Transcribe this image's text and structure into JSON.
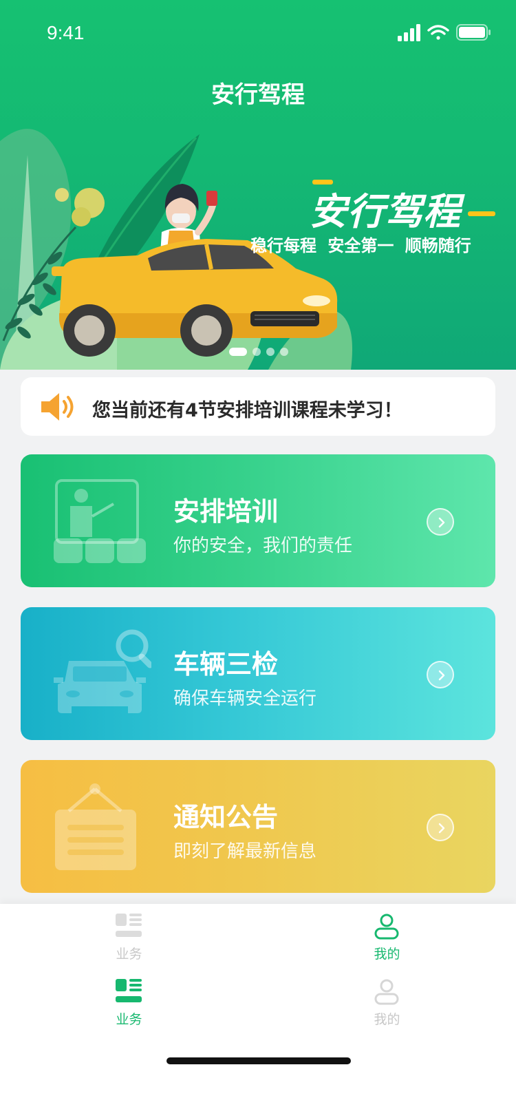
{
  "status_bar": {
    "time": "9:41"
  },
  "header": {
    "title": "安行驾程"
  },
  "banner": {
    "slogan": "安行驾程",
    "tagline": "稳行每程 安全第一 顺畅随行",
    "slide_count": 4,
    "active_slide": 1
  },
  "notice": {
    "icon": "speaker-icon",
    "text": "您当前还有4节安排培训课程未学习！"
  },
  "cards": [
    {
      "title": "安排培训",
      "subtitle": "你的安全，我们的责任",
      "icon": "classroom-icon"
    },
    {
      "title": "车辆三检",
      "subtitle": "确保车辆安全运行",
      "icon": "car-inspection-icon"
    },
    {
      "title": "通知公告",
      "subtitle": "即刻了解最新信息",
      "icon": "notice-board-icon"
    }
  ],
  "tabbars": [
    {
      "tabs": [
        {
          "label": "业务",
          "icon": "business-icon",
          "active": false
        },
        {
          "label": "我的",
          "icon": "user-icon",
          "active": true
        }
      ]
    },
    {
      "tabs": [
        {
          "label": "业务",
          "icon": "business-icon",
          "active": true
        },
        {
          "label": "我的",
          "icon": "user-icon",
          "active": false
        }
      ]
    }
  ],
  "colors": {
    "brand_green": "#17b86f",
    "training_card": "#19c073",
    "inspection_card": "#18b0c8",
    "notice_card": "#f6be43",
    "notice_icon": "#f5a331",
    "tab_inactive": "#c7c7c7"
  }
}
